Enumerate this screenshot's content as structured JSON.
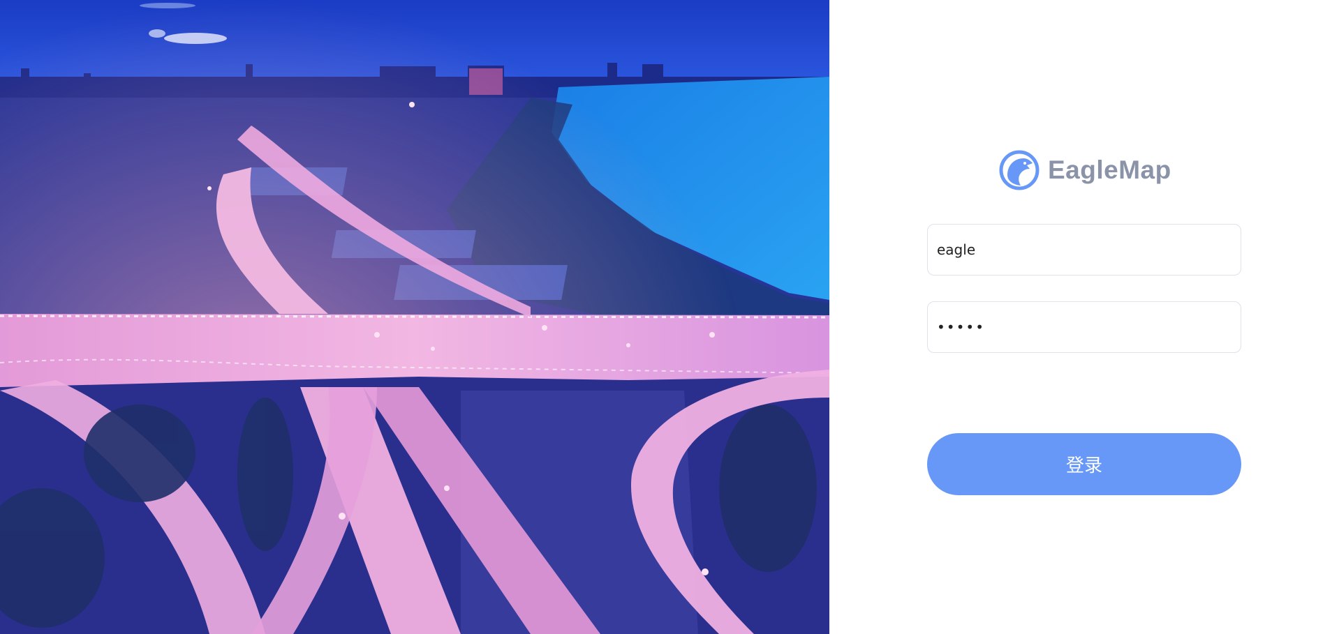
{
  "brand": {
    "name": "EagleMap",
    "logo_icon": "eagle-logo-icon",
    "name_color": "#8b93a8",
    "logo_color": "#6798f7"
  },
  "login_form": {
    "username": {
      "value": "eagle"
    },
    "password": {
      "value": "•••••"
    },
    "submit_label": "登录",
    "button_color": "#6798f7"
  },
  "hero": {
    "image": "city-overpass-night-photo"
  }
}
